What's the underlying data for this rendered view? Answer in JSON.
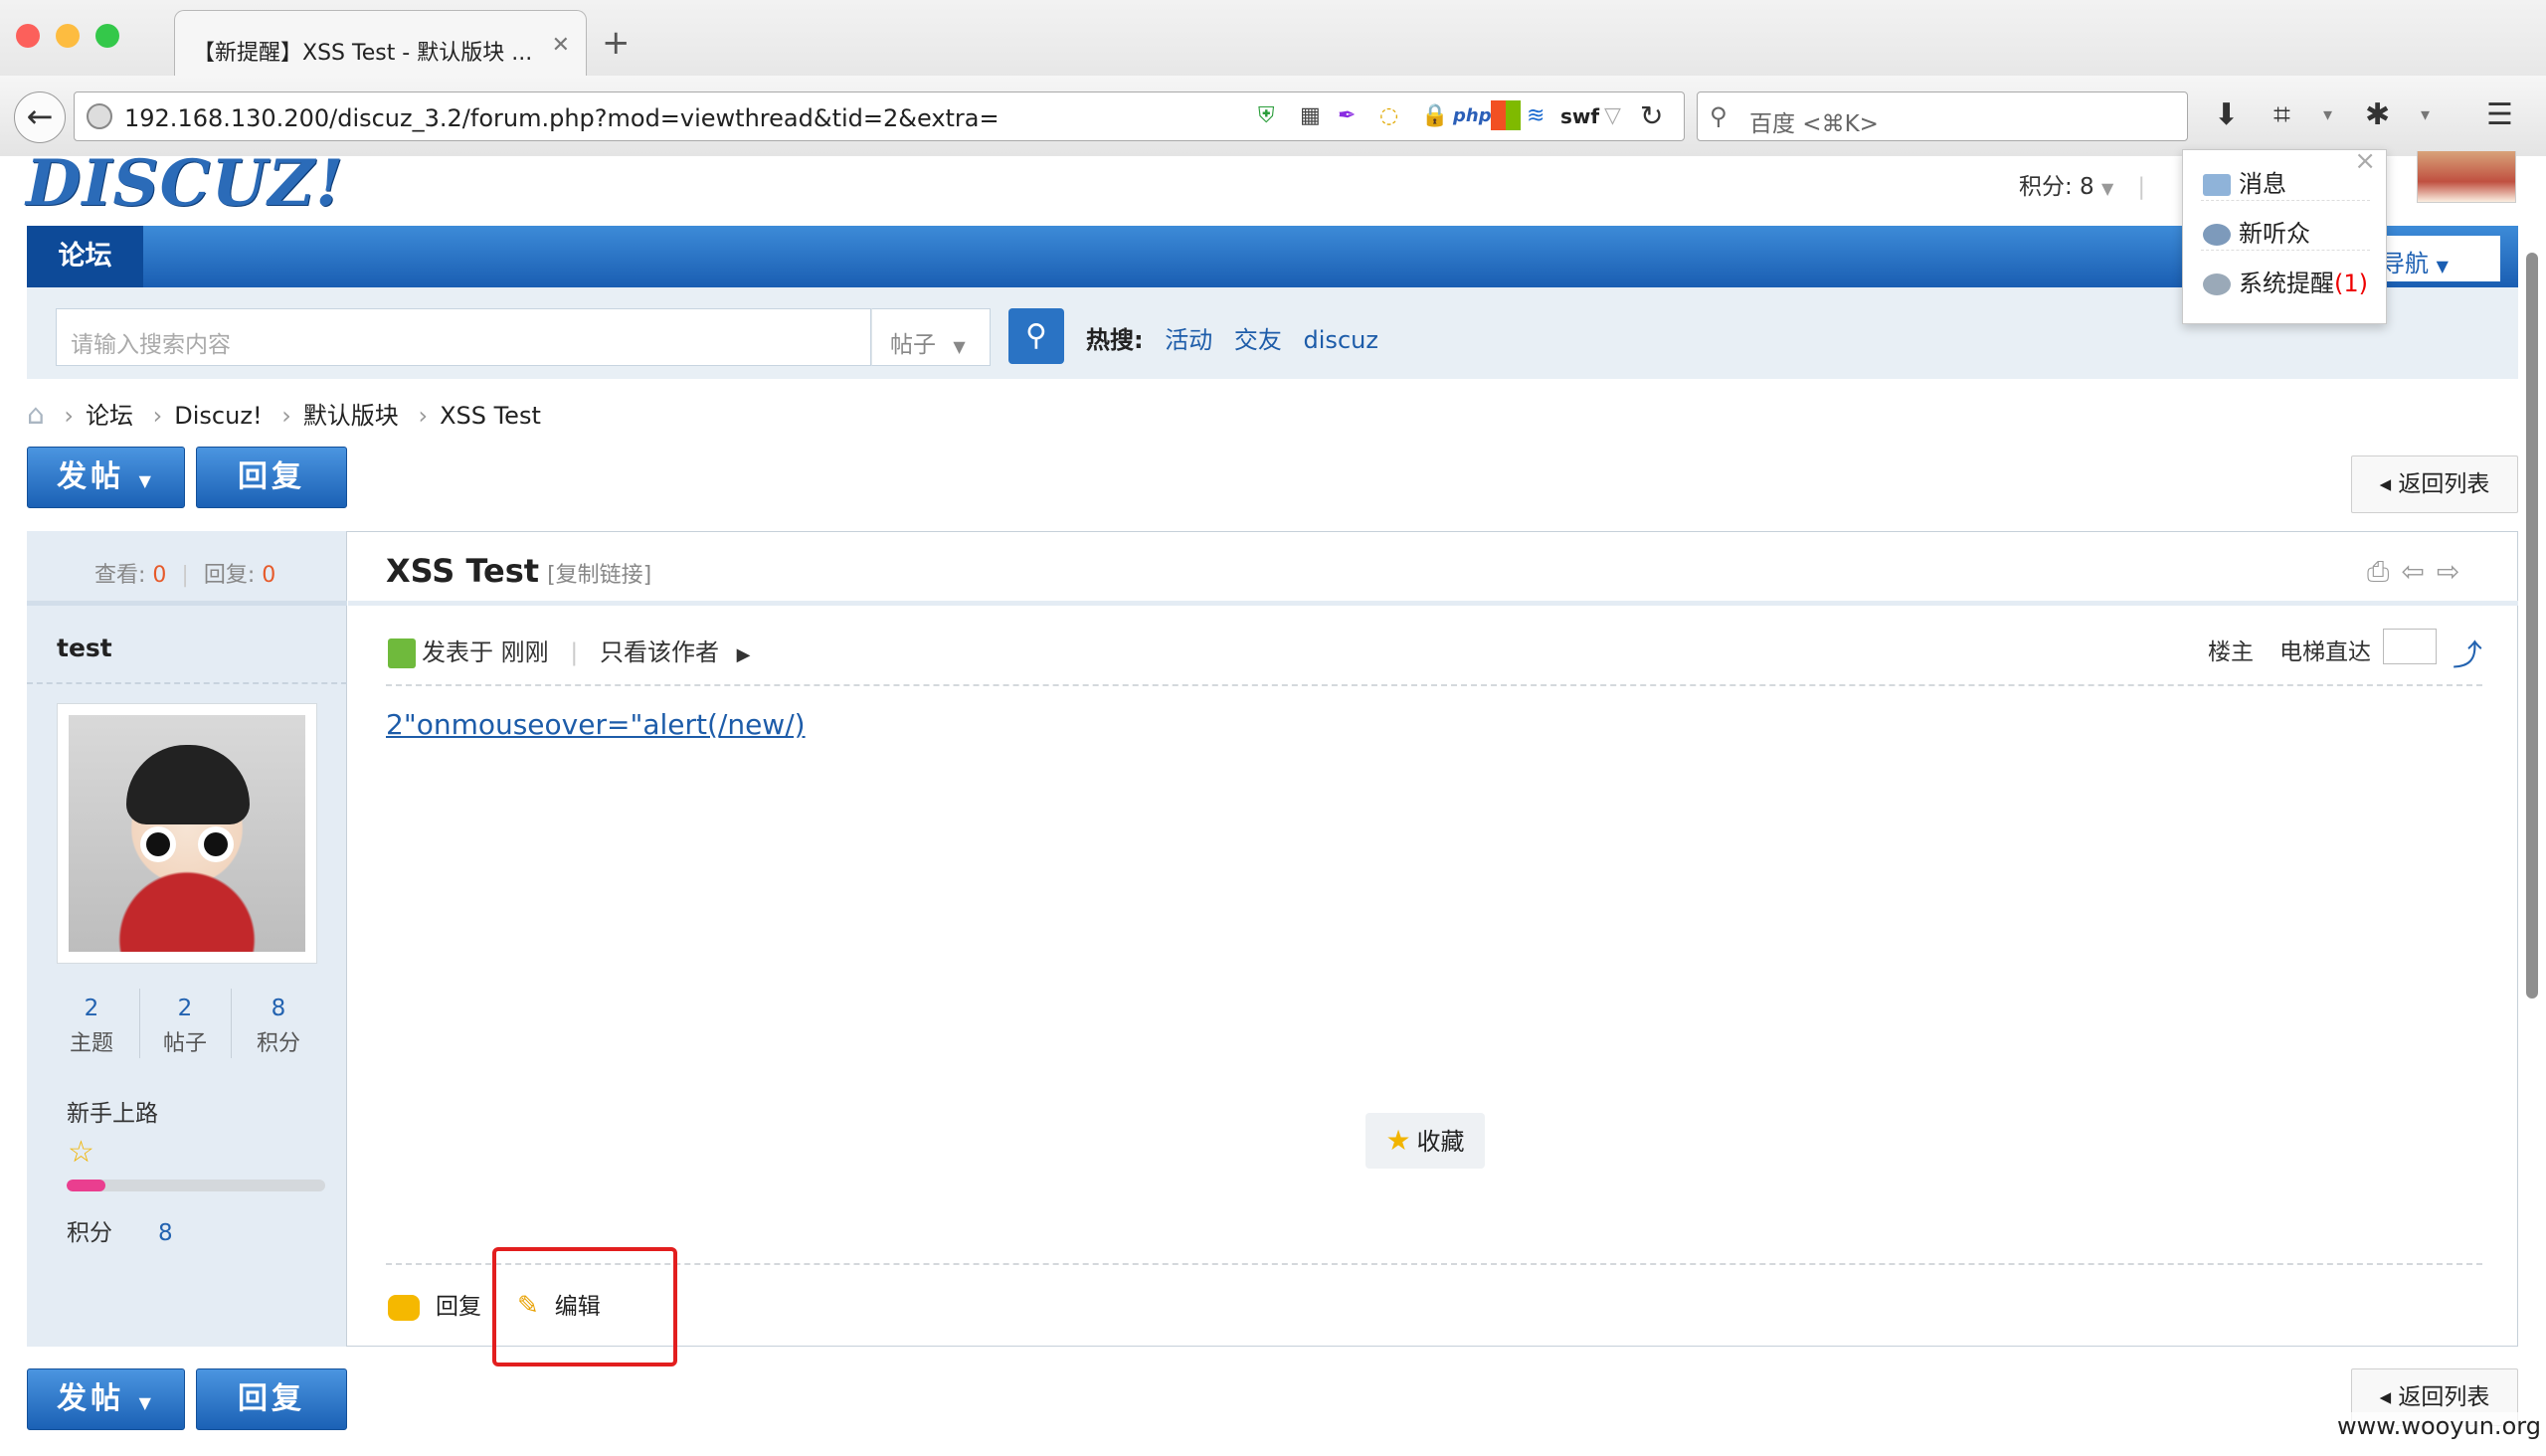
{
  "browser": {
    "tab_title": "【新提醒】XSS Test - 默认版块 ...",
    "tab_close": "✕",
    "new_tab": "+",
    "url": "192.168.130.200/discuz_3.2/forum.php?mod=viewthread&tid=2&extra=",
    "search_placeholder": "百度 <⌘K>",
    "ext_php": "php",
    "ext_swf": "swf"
  },
  "site": {
    "logo": "DISCUZ!",
    "score_label": "积分: 8",
    "nav_forum": "论坛",
    "quick_nav": "导航",
    "search_placeholder": "请输入搜索内容",
    "search_type": "帖子",
    "hot_label": "热搜:",
    "hot_terms": [
      "活动",
      "交友",
      "discuz"
    ]
  },
  "popup": {
    "items": [
      "消息",
      "新听众",
      "系统提醒"
    ],
    "reminder_count": "(1)"
  },
  "breadcrumb": [
    "论坛",
    "Discuz!",
    "默认版块",
    "XSS Test"
  ],
  "buttons": {
    "post": "发帖",
    "reply": "回复",
    "back_list": "返回列表"
  },
  "thread": {
    "views_label": "查看:",
    "views": "0",
    "replies_label": "回复:",
    "replies": "0",
    "title": "XSS Test",
    "copy_link": "[复制链接]",
    "posted": "发表于 刚刚",
    "only_author": "只看该作者",
    "floor": "楼主",
    "elevator": "电梯直达",
    "content": "2\"onmouseover=\"alert(/new/)",
    "favorite": "收藏",
    "act_reply": "回复",
    "act_edit": "编辑"
  },
  "author": {
    "name": "test",
    "topics": "2",
    "topics_label": "主题",
    "posts": "2",
    "posts_label": "帖子",
    "credits": "8",
    "credits_label": "积分",
    "rank": "新手上路",
    "progress": 0.15,
    "score_label": "积分",
    "score": "8"
  },
  "watermark": "www.wooyun.org",
  "colors": {
    "accent": "#1a5eb2",
    "highlight_box": "#e21e1e",
    "progress": "#ea3e8f"
  }
}
